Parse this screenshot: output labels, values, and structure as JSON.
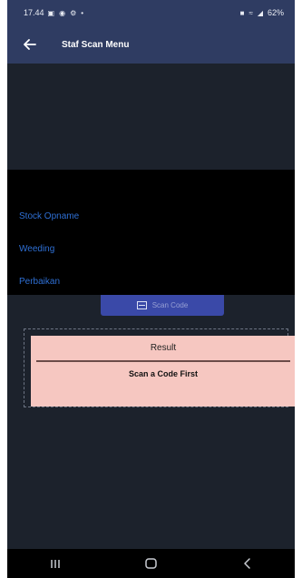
{
  "status_bar": {
    "time": "17.44",
    "left_icons": [
      "gallery-icon",
      "messenger-icon",
      "settings-icon",
      "dot-icon"
    ],
    "right_icons": [
      "battery-saver-icon",
      "wifi-icon",
      "signal-icon"
    ],
    "battery": "62%"
  },
  "app_bar": {
    "title": "Staf Scan Menu",
    "back_icon": "arrow-left-icon"
  },
  "menu": {
    "items": [
      {
        "label": "Stock Opname"
      },
      {
        "label": "Weeding"
      },
      {
        "label": "Perbaikan"
      }
    ]
  },
  "scan_button": {
    "icon": "qr-scan-icon",
    "label": "Scan Code"
  },
  "result": {
    "title": "Result",
    "message": "Scan a Code First"
  },
  "nav_bar": {
    "icons": [
      "recent-apps-icon",
      "home-icon",
      "back-icon"
    ]
  },
  "colors": {
    "app_bar": "#2f3c62",
    "background": "#1c222c",
    "menu_text": "#2e6fd4",
    "scan_button": "#3a49a8",
    "result_card": "#f6c7c1"
  }
}
